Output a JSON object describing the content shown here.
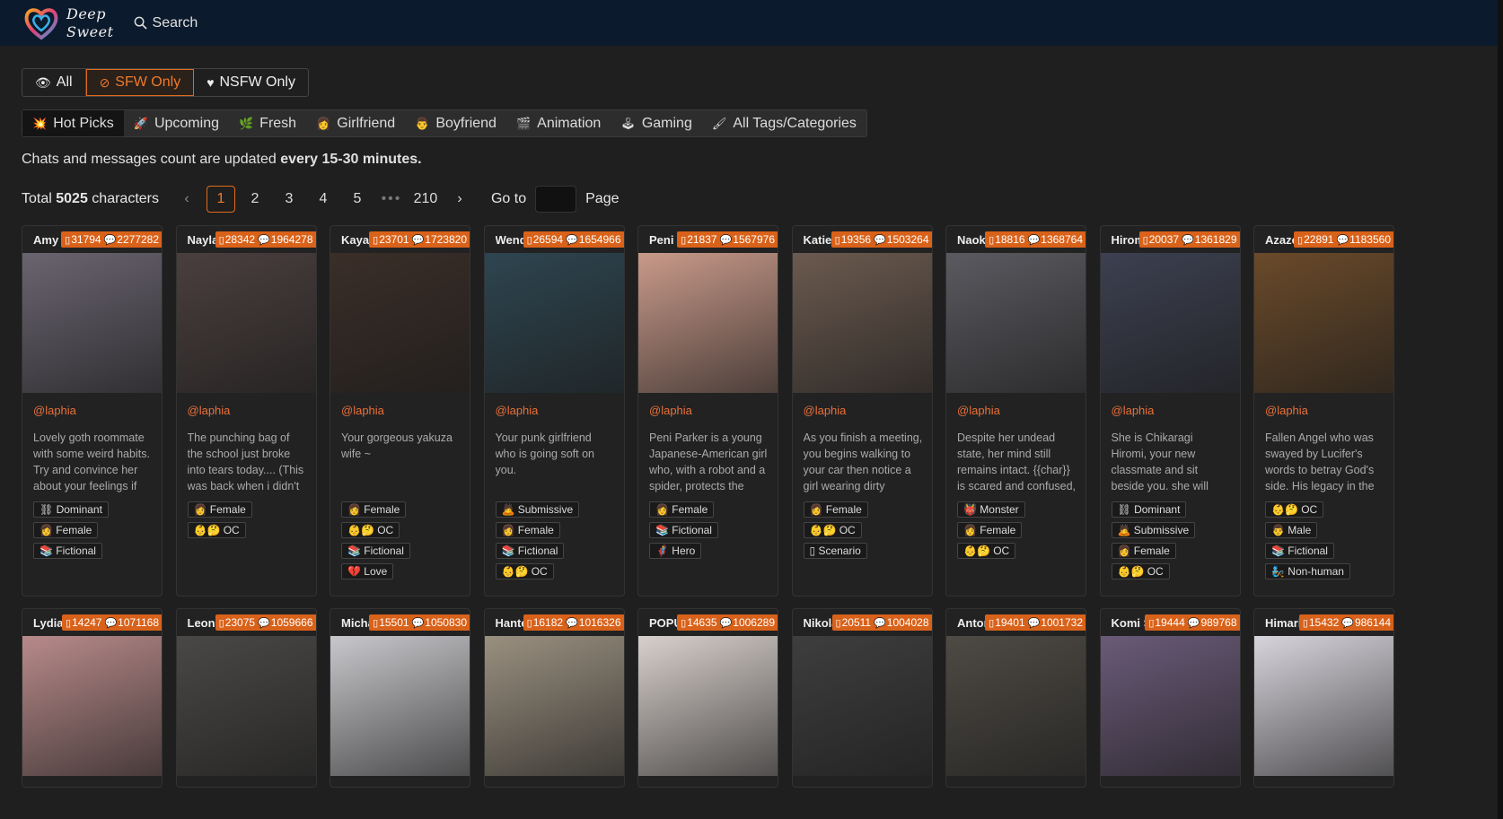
{
  "header": {
    "logo_line1": "Deep",
    "logo_line2": "Sweet",
    "search_label": "Search"
  },
  "filters": [
    {
      "icon": "eye-icon",
      "label": "All",
      "active": false
    },
    {
      "icon": "eye-slash-icon",
      "label": "SFW Only",
      "active": true
    },
    {
      "icon": "heart-icon",
      "label": "NSFW Only",
      "active": false
    }
  ],
  "tabs": [
    {
      "emoji": "💥",
      "label": "Hot Picks",
      "active": true
    },
    {
      "emoji": "🚀",
      "label": "Upcoming"
    },
    {
      "emoji": "🌿",
      "label": "Fresh"
    },
    {
      "emoji": "👩",
      "label": "Girlfriend"
    },
    {
      "emoji": "👨",
      "label": "Boyfriend"
    },
    {
      "emoji": "🎬",
      "label": "Animation"
    },
    {
      "emoji": "🕹",
      "label": "Gaming"
    },
    {
      "emoji": "🖌",
      "label": "All Tags/Categories"
    }
  ],
  "notice": {
    "text": "Chats and messages count are updated ",
    "bold": "every 15-30 minutes."
  },
  "pagination": {
    "total_prefix": "Total ",
    "total_count": "5025",
    "total_suffix": " characters",
    "pages": [
      "1",
      "2",
      "3",
      "4",
      "5",
      "•••",
      "210"
    ],
    "goto_label": "Go to",
    "page_label": "Page"
  },
  "cards_row1": [
    {
      "name": "Amy Th",
      "chats": "31794",
      "messages": "2277282",
      "author": "@laphia",
      "desc": "Lovely goth roommate with some weird habits. Try and convince her about your feelings if you can",
      "tags": [
        "⛓ Dominant",
        "👩 Female",
        "📚 Fictional"
      ],
      "color": "#6a6470"
    },
    {
      "name": "Nayla",
      "chats": "28342",
      "messages": "1964278",
      "author": "@laphia",
      "desc": "The punching bag of the school just broke into tears today.... (This was back when i didn't real...",
      "tags": [
        "👩 Female",
        "👶🤔 OC"
      ],
      "color": "#4a3f3e"
    },
    {
      "name": "Kaya H",
      "chats": "23701",
      "messages": "1723820",
      "author": "@laphia",
      "desc": "Your gorgeous yakuza wife ~",
      "tags": [
        "👩 Female",
        "👶🤔 OC",
        "📚 Fictional",
        "💔 Love"
      ],
      "color": "#3a2e28"
    },
    {
      "name": "Wendy",
      "chats": "26594",
      "messages": "1654966",
      "author": "@laphia",
      "desc": "Your punk girlfriend who is going soft on you.",
      "tags": [
        "🙇 Submissive",
        "👩 Female",
        "📚 Fictional",
        "👶🤔 OC"
      ],
      "color": "#2e4550"
    },
    {
      "name": "Peni Pa",
      "chats": "21837",
      "messages": "1567976",
      "author": "@laphia",
      "desc": "Peni Parker is a young Japanese-American girl who, with a robot and a spider, protects the New Yo...",
      "tags": [
        "👩 Female",
        "📚 Fictional",
        "🦸 Hero"
      ],
      "color": "#c99a8a"
    },
    {
      "name": "Katie",
      "chats": "19356",
      "messages": "1503264",
      "author": "@laphia",
      "desc": "As you finish a meeting, you begins walking to your car then notice a girl wearing dirty clothes ...",
      "tags": [
        "👩 Female",
        "👶🤔 OC",
        "▯ Scenario"
      ],
      "color": "#6b5a4f"
    },
    {
      "name": "Naoka",
      "chats": "18816",
      "messages": "1368764",
      "author": "@laphia",
      "desc": "Despite her undead state, her mind still remains intact. {{char}} is scared and confused, not ful...",
      "tags": [
        "👹 Monster",
        "👩 Female",
        "👶🤔 OC"
      ],
      "color": "#5a5a60"
    },
    {
      "name": "Hiromi",
      "chats": "20037",
      "messages": "1361829",
      "author": "@laphia",
      "desc": "She is Chikaragi Hiromi, your new classmate and sit beside you. she will annoy you everytime",
      "tags": [
        "⛓ Dominant",
        "🙇 Submissive",
        "👩 Female",
        "👶🤔 OC"
      ],
      "color": "#3c4050"
    },
    {
      "name": "Azazel",
      "chats": "22891",
      "messages": "1183560",
      "author": "@laphia",
      "desc": "Fallen Angel who was swayed by Lucifer's words to betray God's side. His legacy in the human worl...",
      "tags": [
        "👶🤔 OC",
        "👨 Male",
        "📚 Fictional",
        "🧞 Non-human"
      ],
      "color": "#6a4a2a"
    }
  ],
  "cards_row2": [
    {
      "name": "Lydia",
      "chats": "14247",
      "messages": "1071168",
      "color": "#b88a8a"
    },
    {
      "name": "Leon K",
      "chats": "23075",
      "messages": "1059666",
      "color": "#4a4846"
    },
    {
      "name": "Michae",
      "chats": "15501",
      "messages": "1050830",
      "color": "#c8c8cc"
    },
    {
      "name": "Hanter",
      "chats": "16182",
      "messages": "1016326",
      "color": "#9a9080"
    },
    {
      "name": "POPUL",
      "chats": "14635",
      "messages": "1006289",
      "color": "#d8d0cc"
    },
    {
      "name": "Nikolaj",
      "chats": "20511",
      "messages": "1004028",
      "color": "#3e3e3e"
    },
    {
      "name": "Anton",
      "chats": "19401",
      "messages": "1001732",
      "color": "#4e4a44"
    },
    {
      "name": "Komi Sh",
      "chats": "19444",
      "messages": "989768",
      "color": "#6a5a78"
    },
    {
      "name": "Himari",
      "chats": "15432",
      "messages": "986144",
      "color": "#d8d4dc"
    }
  ]
}
